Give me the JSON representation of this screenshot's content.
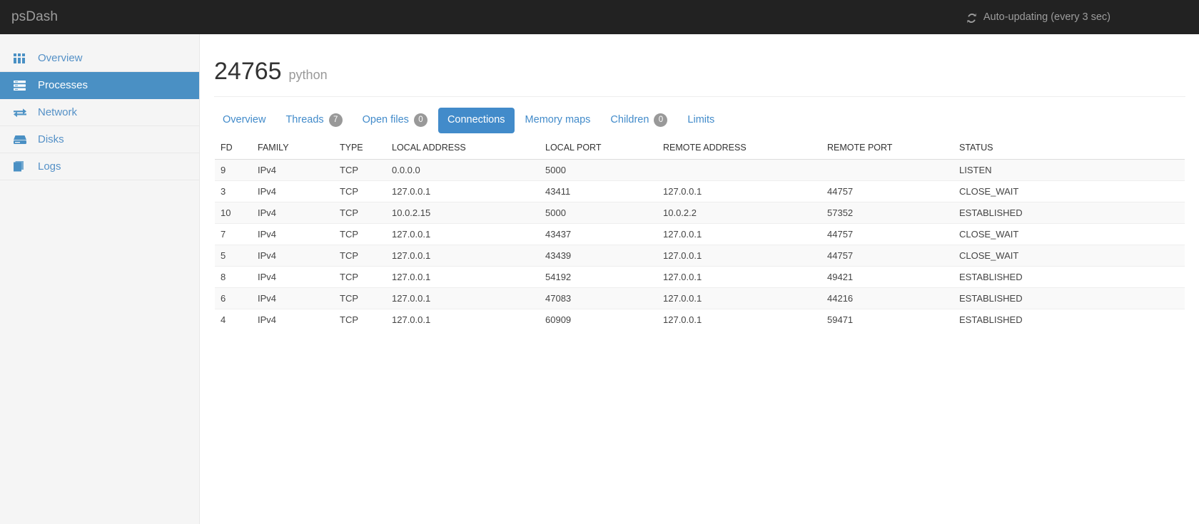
{
  "navbar": {
    "brand": "psDash",
    "refresh_icon": "refresh-icon",
    "auto_update_text": "Auto-updating (every 3 sec)",
    "background_color": "#222222",
    "text_color": "#9d9d9d"
  },
  "sidebar": {
    "background_color": "#f5f5f5",
    "active_color": "#4a90c4",
    "link_color": "#5591c7",
    "items": [
      {
        "label": "Overview",
        "icon": "grid-icon",
        "active": false,
        "name": "sidebar-item-overview"
      },
      {
        "label": "Processes",
        "icon": "server-icon",
        "active": true,
        "name": "sidebar-item-processes"
      },
      {
        "label": "Network",
        "icon": "exchange-icon",
        "active": false,
        "name": "sidebar-item-network"
      },
      {
        "label": "Disks",
        "icon": "hdd-icon",
        "active": false,
        "name": "sidebar-item-disks"
      },
      {
        "label": "Logs",
        "icon": "book-icon",
        "active": false,
        "name": "sidebar-item-logs"
      }
    ]
  },
  "page": {
    "pid": "24765",
    "process_name": "python"
  },
  "tabs": {
    "accent_color": "#428bca",
    "badge_color": "#999999",
    "items": [
      {
        "label": "Overview",
        "badge": null,
        "active": false,
        "name": "tab-overview"
      },
      {
        "label": "Threads",
        "badge": "7",
        "active": false,
        "name": "tab-threads"
      },
      {
        "label": "Open files",
        "badge": "0",
        "active": false,
        "name": "tab-open-files"
      },
      {
        "label": "Connections",
        "badge": null,
        "active": true,
        "name": "tab-connections"
      },
      {
        "label": "Memory maps",
        "badge": null,
        "active": false,
        "name": "tab-memory-maps"
      },
      {
        "label": "Children",
        "badge": "0",
        "active": false,
        "name": "tab-children"
      },
      {
        "label": "Limits",
        "badge": null,
        "active": false,
        "name": "tab-limits"
      }
    ]
  },
  "connections_table": {
    "columns": [
      "FD",
      "FAMILY",
      "TYPE",
      "LOCAL ADDRESS",
      "LOCAL PORT",
      "REMOTE ADDRESS",
      "REMOTE PORT",
      "STATUS"
    ],
    "rows": [
      {
        "fd": "9",
        "family": "IPv4",
        "type": "TCP",
        "local_address": "0.0.0.0",
        "local_port": "5000",
        "remote_address": "",
        "remote_port": "",
        "status": "LISTEN"
      },
      {
        "fd": "3",
        "family": "IPv4",
        "type": "TCP",
        "local_address": "127.0.0.1",
        "local_port": "43411",
        "remote_address": "127.0.0.1",
        "remote_port": "44757",
        "status": "CLOSE_WAIT"
      },
      {
        "fd": "10",
        "family": "IPv4",
        "type": "TCP",
        "local_address": "10.0.2.15",
        "local_port": "5000",
        "remote_address": "10.0.2.2",
        "remote_port": "57352",
        "status": "ESTABLISHED"
      },
      {
        "fd": "7",
        "family": "IPv4",
        "type": "TCP",
        "local_address": "127.0.0.1",
        "local_port": "43437",
        "remote_address": "127.0.0.1",
        "remote_port": "44757",
        "status": "CLOSE_WAIT"
      },
      {
        "fd": "5",
        "family": "IPv4",
        "type": "TCP",
        "local_address": "127.0.0.1",
        "local_port": "43439",
        "remote_address": "127.0.0.1",
        "remote_port": "44757",
        "status": "CLOSE_WAIT"
      },
      {
        "fd": "8",
        "family": "IPv4",
        "type": "TCP",
        "local_address": "127.0.0.1",
        "local_port": "54192",
        "remote_address": "127.0.0.1",
        "remote_port": "49421",
        "status": "ESTABLISHED"
      },
      {
        "fd": "6",
        "family": "IPv4",
        "type": "TCP",
        "local_address": "127.0.0.1",
        "local_port": "47083",
        "remote_address": "127.0.0.1",
        "remote_port": "44216",
        "status": "ESTABLISHED"
      },
      {
        "fd": "4",
        "family": "IPv4",
        "type": "TCP",
        "local_address": "127.0.0.1",
        "local_port": "60909",
        "remote_address": "127.0.0.1",
        "remote_port": "59471",
        "status": "ESTABLISHED"
      }
    ]
  }
}
